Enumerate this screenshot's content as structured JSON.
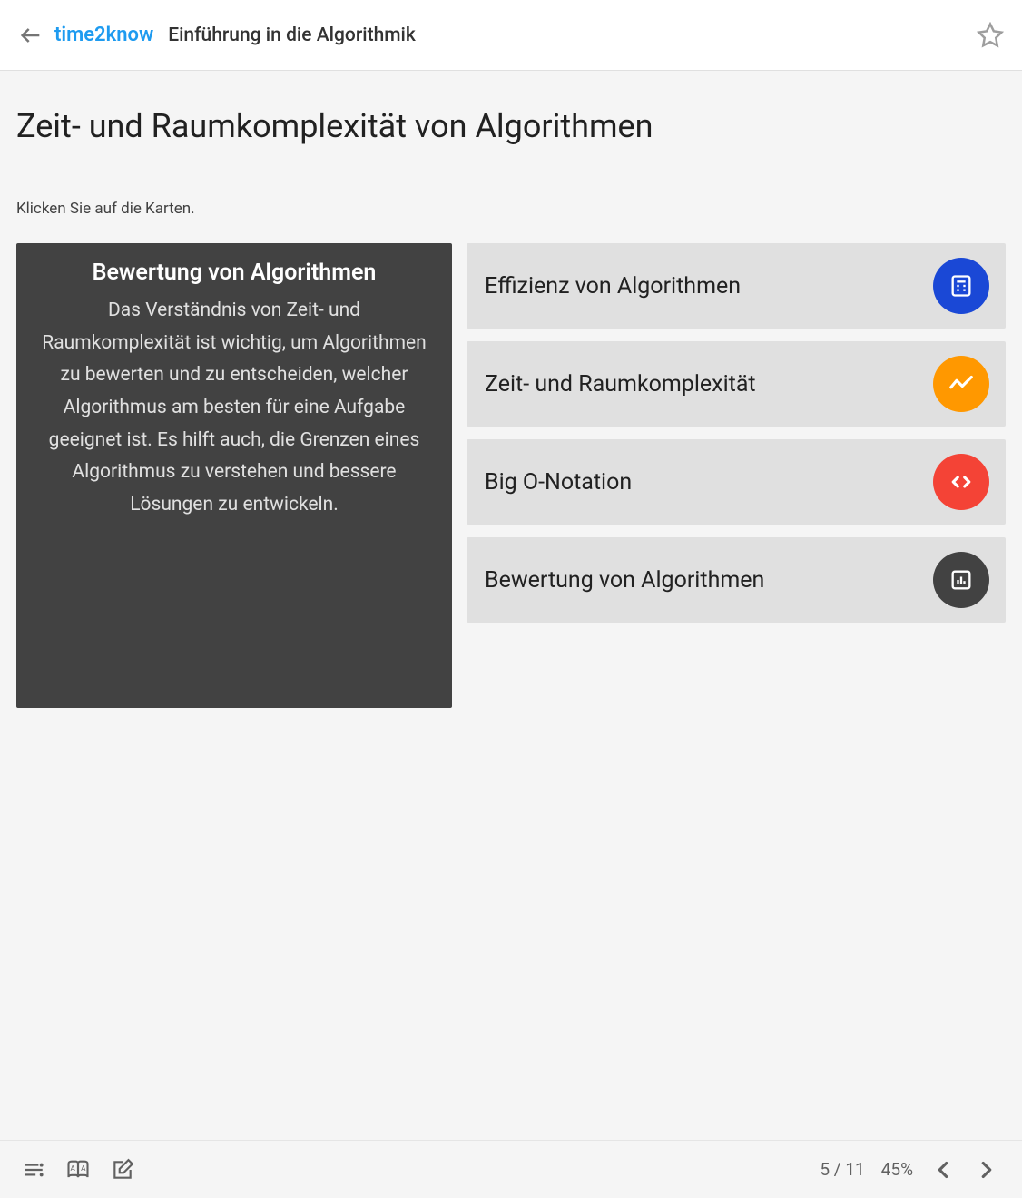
{
  "header": {
    "brand": "time2know",
    "course_title": "Einführung in die Algorithmik"
  },
  "main": {
    "page_title": "Zeit- und Raumkomplexität von Algorithmen",
    "instruction": "Klicken Sie auf die Karten.",
    "expanded_card": {
      "title": "Bewertung von Algorithmen",
      "body": "Das Verständnis von Zeit- und Raumkomplexität ist wichtig, um Algorithmen zu bewerten und zu entscheiden, welcher Algorithmus am besten für eine Aufgabe geeignet ist. Es hilft auch, die Grenzen eines Algorithmus zu verstehen und bessere Lösungen zu entwickeln."
    },
    "cards": [
      {
        "label": "Effizienz von Algorithmen",
        "icon": "calculator-icon",
        "color": "blue"
      },
      {
        "label": "Zeit- und Raumkomplexität",
        "icon": "trend-icon",
        "color": "orange"
      },
      {
        "label": "Big O-Notation",
        "icon": "code-icon",
        "color": "red"
      },
      {
        "label": "Bewertung von Algorithmen",
        "icon": "chart-icon",
        "color": "dark"
      }
    ]
  },
  "footer": {
    "page_indicator": "5 / 11",
    "progress": "45%"
  }
}
